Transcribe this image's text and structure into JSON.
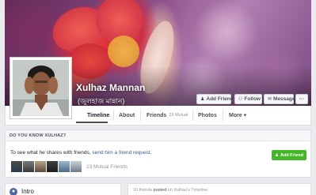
{
  "profile": {
    "name": "Xulhaz Mannan",
    "alt_name": "(জুলহাজ মান্নান)"
  },
  "cover_actions": {
    "add_friend": "Add Friend",
    "follow": "Follow",
    "message": "Message",
    "more": "···"
  },
  "nav": {
    "timeline": "Timeline",
    "about": "About",
    "friends": "Friends",
    "friends_count": "23 Mutual",
    "photos": "Photos",
    "more": "More ▾"
  },
  "know_card": {
    "heading": "DO YOU KNOW XULHAZ?",
    "text_prefix": "To see what he shares with friends, ",
    "link": "send him a friend request.",
    "button": "Add Friend",
    "mutual": "23 Mutual Friends"
  },
  "intro": {
    "label": "Intro"
  },
  "posts": {
    "prefix": "10 friends",
    "middle": " posted ",
    "suffix": "on Xulhaz's Timeline."
  },
  "colors": {
    "link": "#365899",
    "green_button": "#42b72a",
    "background": "#e9ebee"
  }
}
